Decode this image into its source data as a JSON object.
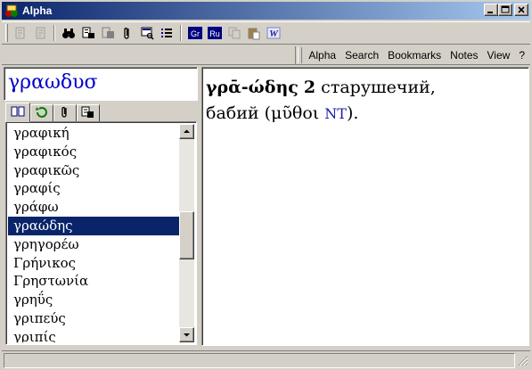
{
  "window": {
    "title": "Alpha"
  },
  "caption_buttons": [
    "minimize-icon",
    "maximize-icon",
    "close-icon"
  ],
  "toolbar": {
    "items": [
      "back-page-icon",
      "forward-page-icon",
      "binoculars-icon",
      "dictionary-search-icon",
      "dictionary-copy-icon",
      "paperclip-icon",
      "screen-search-icon",
      "list-icon",
      "greek-button",
      "russian-button",
      "copy-icon",
      "paste-icon",
      "word-icon"
    ],
    "gr_label": "Gr",
    "ru_label": "Ru",
    "w_label": "W"
  },
  "menu": {
    "items": [
      "Alpha",
      "Search",
      "Bookmarks",
      "Notes",
      "View",
      "?"
    ]
  },
  "search": {
    "value": "γραωδυσ"
  },
  "tabs": [
    "book-icon",
    "history-icon",
    "paperclip-icon",
    "dictionary-icon"
  ],
  "word_list": {
    "items": [
      "γραφική",
      "γραφικός",
      "γραφικῶς",
      "γραφίς",
      "γράφω",
      "γραώδης",
      "γρηγορέω",
      "Γρήνικος",
      "Γρηστωνία",
      "γρηΰς",
      "γριπεύς",
      "γριπίς"
    ],
    "selected": "γραώδης"
  },
  "article": {
    "headword": "γρᾱ-ώδης",
    "sense": "2",
    "line1_text": "старушечий,",
    "line2_text": "бабий (μῦθοι ",
    "abbr": "NT",
    "line2_end": ")."
  },
  "colors": {
    "titlebar_start": "#0a246a",
    "titlebar_end": "#a6caf0",
    "selection": "#0a246a",
    "search_text": "#0000cc",
    "abbr": "#1a1aa6",
    "face": "#d4d0c8"
  }
}
